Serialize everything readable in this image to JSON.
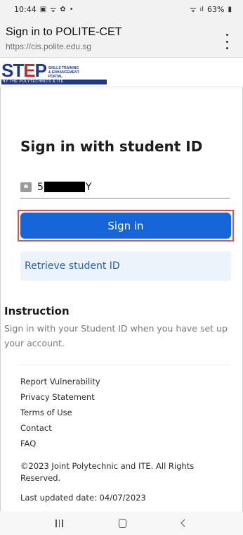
{
  "status_bar": {
    "time": "10:44",
    "icons_left": [
      "gallery-icon",
      "wifi-calling-icon",
      "settings-icon",
      "dot-icon"
    ],
    "battery": "63%",
    "icons_right": [
      "wifi-icon",
      "signal-icon",
      "battery-icon"
    ]
  },
  "browser": {
    "title": "Sign in to POLITE-CET",
    "url": "https://cis.polite.edu.sg"
  },
  "logo": {
    "brand_prefix": "ST",
    "brand_e": "E",
    "brand_suffix": "P",
    "sub_line1": "SKILLS TRAINING",
    "sub_line2": "& ENHANCEMENT",
    "sub_line3": "PORTAL",
    "strip": "BY THE POLYTECHNICS & ITE",
    "colors": {
      "primary": "#1e3a8a",
      "accent": "#c62828"
    }
  },
  "form": {
    "heading": "Sign in with student ID",
    "student_id_prefix": "5",
    "student_id_suffix": "Y",
    "sign_in_label": "Sign in",
    "retrieve_label": "Retrieve student ID",
    "colors": {
      "button": "#1565d8",
      "highlight": "#d9534f"
    }
  },
  "instruction": {
    "title": "Instruction",
    "text": "Sign in with your Student ID when you have set up your account."
  },
  "footer": {
    "links": [
      "Report Vulnerability",
      "Privacy Statement",
      "Terms of Use",
      "Contact",
      "FAQ"
    ],
    "copyright": "©2023 Joint Polytechnic and ITE. All Rights Reserved.",
    "last_updated": "Last updated date: 04/07/2023"
  }
}
